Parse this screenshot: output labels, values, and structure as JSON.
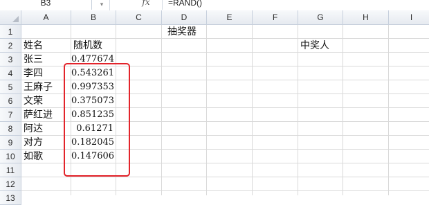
{
  "formula_bar": {
    "name_box": "B3",
    "dropdown_icon": "chevron-down-icon",
    "fx_label": "fx",
    "formula": "=RAND()"
  },
  "columns": [
    "A",
    "B",
    "C",
    "D",
    "E",
    "F",
    "G",
    "H",
    "I"
  ],
  "rows": [
    "1",
    "2",
    "3",
    "4",
    "5",
    "6",
    "7",
    "8",
    "9",
    "10",
    "11",
    "12",
    "13"
  ],
  "sheet": {
    "title": "抽奖器",
    "header_name": "姓名",
    "header_random": "随机数",
    "winner_label": "中奖人",
    "entries": [
      {
        "name": "张三",
        "value": "0.477674"
      },
      {
        "name": "李四",
        "value": "0.543261"
      },
      {
        "name": "王麻子",
        "value": "0.997353"
      },
      {
        "name": "文荣",
        "value": "0.375073"
      },
      {
        "name": "萨红进",
        "value": "0.851235"
      },
      {
        "name": "阿达",
        "value": "0.61271"
      },
      {
        "name": "对方",
        "value": "0.182045"
      },
      {
        "name": "如歌",
        "value": "0.147606"
      }
    ]
  },
  "highlight_color": "#e3242b"
}
